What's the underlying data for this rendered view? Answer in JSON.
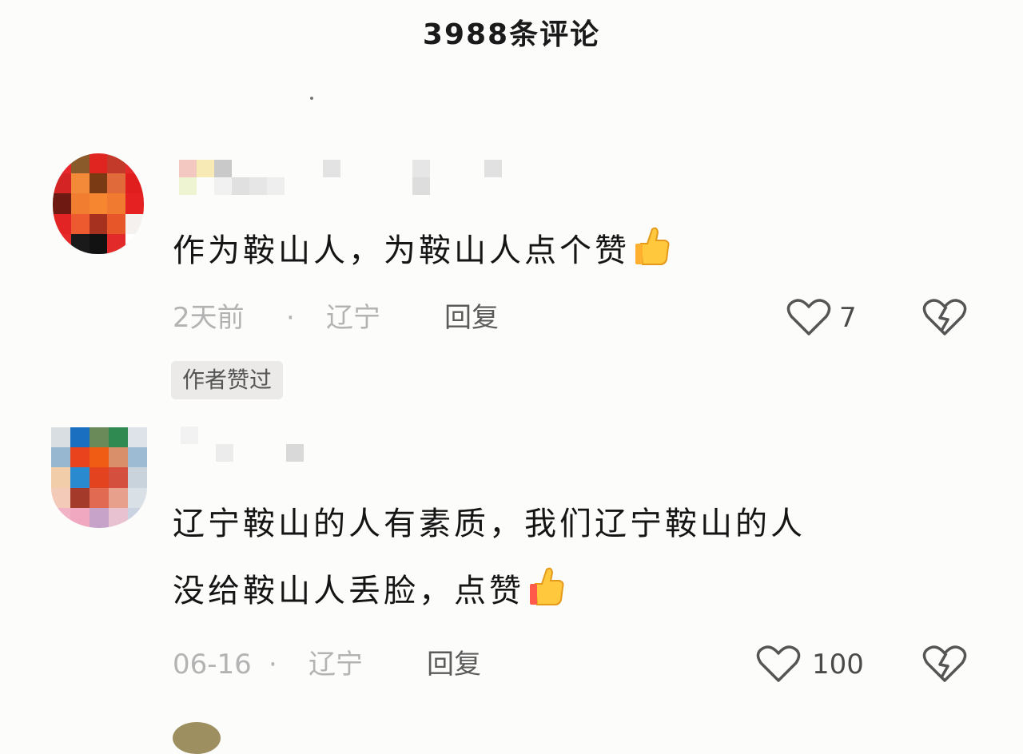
{
  "header": {
    "title": "3988条评论"
  },
  "comments": [
    {
      "text": "作为鞍山人，为鞍山人点个赞",
      "time": "2天前",
      "separator": "·",
      "location": "辽宁",
      "reply_label": "回复",
      "like_count": "7",
      "author_badge": "作者赞过",
      "emoji": "thumbs-up-icon"
    },
    {
      "text_line1": "辽宁鞍山的人有素质，我们辽宁鞍山的人",
      "text_line2": "没给鞍山人丢脸，点赞",
      "time": "06-16",
      "separator": "·",
      "location": "辽宁",
      "reply_label": "回复",
      "like_count": "100",
      "emoji": "thumbs-up-icon"
    }
  ],
  "colors": {
    "heart_outline": "#555555",
    "meta_text": "#b3b3b3",
    "badge_bg": "#eceae8"
  }
}
